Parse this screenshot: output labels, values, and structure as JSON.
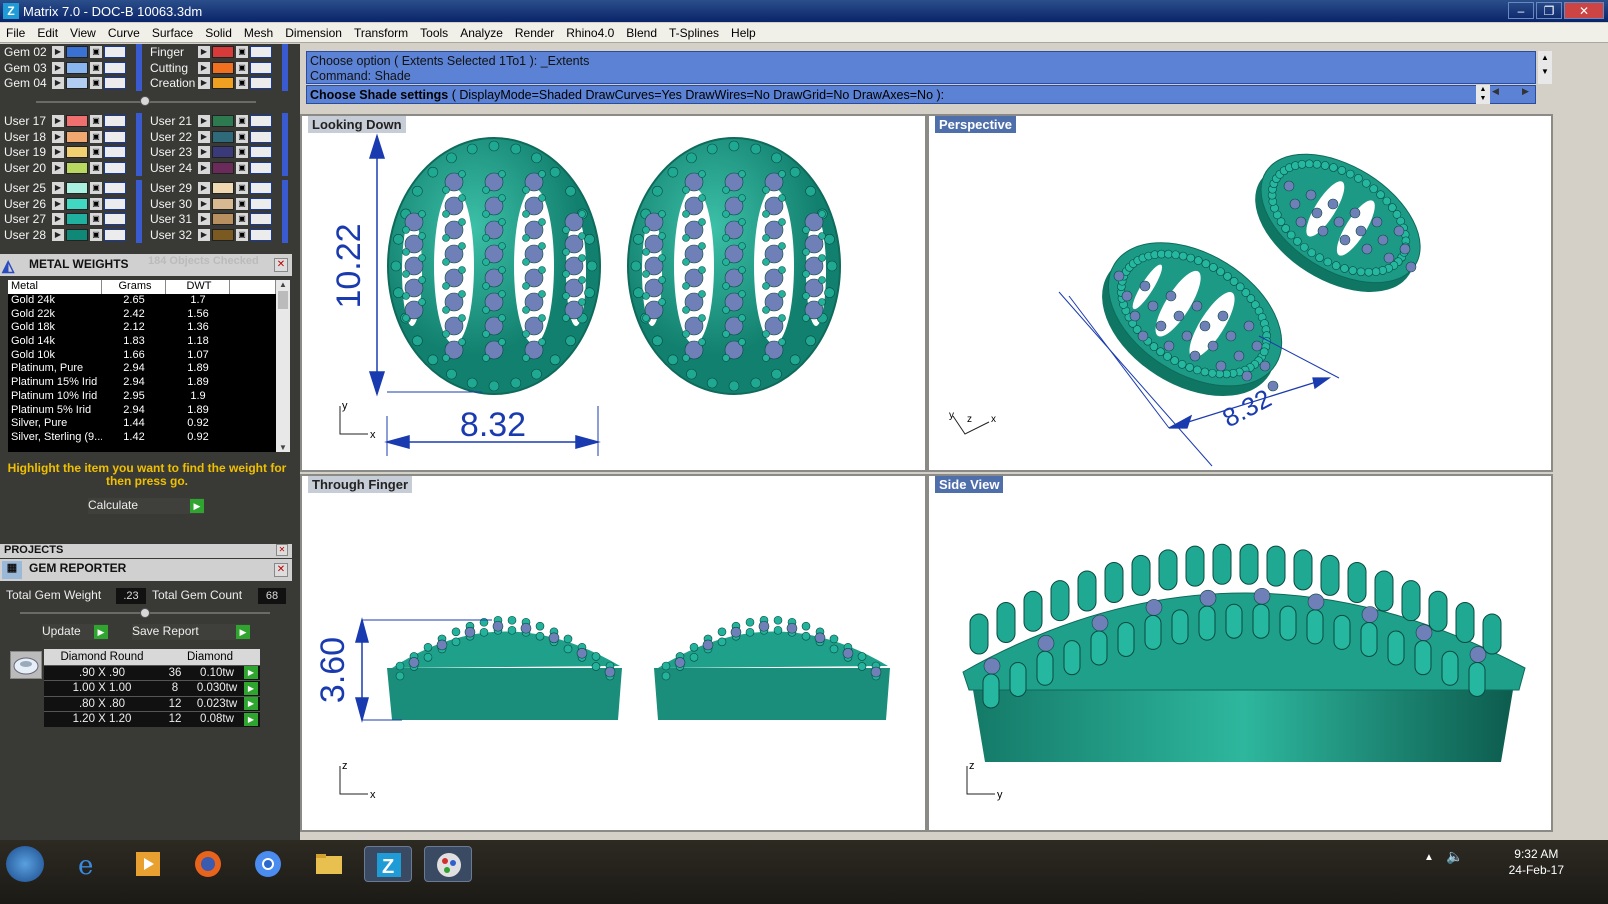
{
  "app": {
    "title": "Matrix 7.0 - DOC-B 10063.3dm",
    "logo": "Z"
  },
  "menu": [
    "File",
    "Edit",
    "View",
    "Curve",
    "Surface",
    "Solid",
    "Mesh",
    "Dimension",
    "Transform",
    "Tools",
    "Analyze",
    "Render",
    "Rhino4.0",
    "Blend",
    "T-Splines",
    "Help"
  ],
  "layers": {
    "g1": [
      {
        "name": "Gem 02",
        "color": "#3a72d4"
      },
      {
        "name": "Gem 03",
        "color": "#8ab6f0"
      },
      {
        "name": "Gem 04",
        "color": "#b2cdf2"
      }
    ],
    "g1b": [
      {
        "name": "Finger",
        "color": "#d83a3a"
      },
      {
        "name": "Cutting",
        "color": "#f07020"
      },
      {
        "name": "Creation",
        "color": "#f0a020"
      }
    ],
    "g2": [
      {
        "name": "User 17",
        "color": "#f07070"
      },
      {
        "name": "User 18",
        "color": "#f0a870"
      },
      {
        "name": "User 19",
        "color": "#f0d070"
      },
      {
        "name": "User 20",
        "color": "#b8d860"
      }
    ],
    "g2b": [
      {
        "name": "User 21",
        "color": "#2e7a50"
      },
      {
        "name": "User 22",
        "color": "#2e6a7a"
      },
      {
        "name": "User 23",
        "color": "#3a3a7a"
      },
      {
        "name": "User 24",
        "color": "#6a2a5a"
      }
    ],
    "g3": [
      {
        "name": "User 25",
        "color": "#a8f0e0"
      },
      {
        "name": "User 26",
        "color": "#40d8c0"
      },
      {
        "name": "User 27",
        "color": "#20b0a0"
      },
      {
        "name": "User 28",
        "color": "#108878"
      }
    ],
    "g3b": [
      {
        "name": "User 29",
        "color": "#f0d8b0"
      },
      {
        "name": "User 30",
        "color": "#d8b890"
      },
      {
        "name": "User 31",
        "color": "#b89060"
      },
      {
        "name": "User 32",
        "color": "#7a5a20"
      }
    ]
  },
  "metal": {
    "title": "METAL WEIGHTS",
    "objects": "184 Objects Checked",
    "headers": [
      "Metal",
      "Grams",
      "DWT"
    ],
    "rows": [
      [
        "Gold 24k",
        "2.65",
        "1.7"
      ],
      [
        "Gold 22k",
        "2.42",
        "1.56"
      ],
      [
        "Gold 18k",
        "2.12",
        "1.36"
      ],
      [
        "Gold 14k",
        "1.83",
        "1.18"
      ],
      [
        "Gold 10k",
        "1.66",
        "1.07"
      ],
      [
        "Platinum, Pure",
        "2.94",
        "1.89"
      ],
      [
        "Platinum 15% Irid",
        "2.94",
        "1.89"
      ],
      [
        "Platinum 10% Irid",
        "2.95",
        "1.9"
      ],
      [
        "Platinum 5% Irid",
        "2.94",
        "1.89"
      ],
      [
        "Silver, Pure",
        "1.44",
        "0.92"
      ],
      [
        "Silver, Sterling (9...",
        "1.42",
        "0.92"
      ]
    ],
    "hint": "Highlight the item you want to find the weight for then press go.",
    "calculate": "Calculate"
  },
  "projects": {
    "title": "PROJECTS"
  },
  "gem": {
    "title": "GEM REPORTER",
    "total_weight_label": "Total Gem Weight",
    "total_weight": ".23",
    "total_count_label": "Total Gem Count",
    "total_count": "68",
    "update": "Update",
    "save": "Save Report",
    "headers": [
      "Diamond Round",
      "Diamond"
    ],
    "rows": [
      [
        ".90 X .90",
        "36",
        "0.10tw"
      ],
      [
        "1.00 X 1.00",
        "8",
        "0.030tw"
      ],
      [
        ".80 X .80",
        "12",
        "0.023tw"
      ],
      [
        "1.20 X 1.20",
        "12",
        "0.08tw"
      ]
    ]
  },
  "command": {
    "line1": "Choose option ( Extents  Selected  1To1 ): _Extents",
    "line2": "Command: Shade",
    "prompt_bold": "Choose Shade settings",
    "prompt_rest": " ( DisplayMode=Shaded  DrawCurves=Yes  DrawWires=No  DrawGrid=No  DrawAxes=No ):"
  },
  "viewports": {
    "tl": "Looking Down",
    "tr": "Perspective",
    "bl": "Through Finger",
    "br": "Side View"
  },
  "dims": {
    "height_top": "10.22",
    "width_top": "8.32",
    "persp": "8.32",
    "side_h": "3.60"
  },
  "axes": {
    "x": "x",
    "y": "y",
    "z": "z"
  },
  "clock": {
    "time": "9:32 AM",
    "date": "24-Feb-17"
  },
  "colors": {
    "teal": "#1f9c88",
    "gem": "#6f7fb8",
    "dim": "#1a3bb0"
  }
}
